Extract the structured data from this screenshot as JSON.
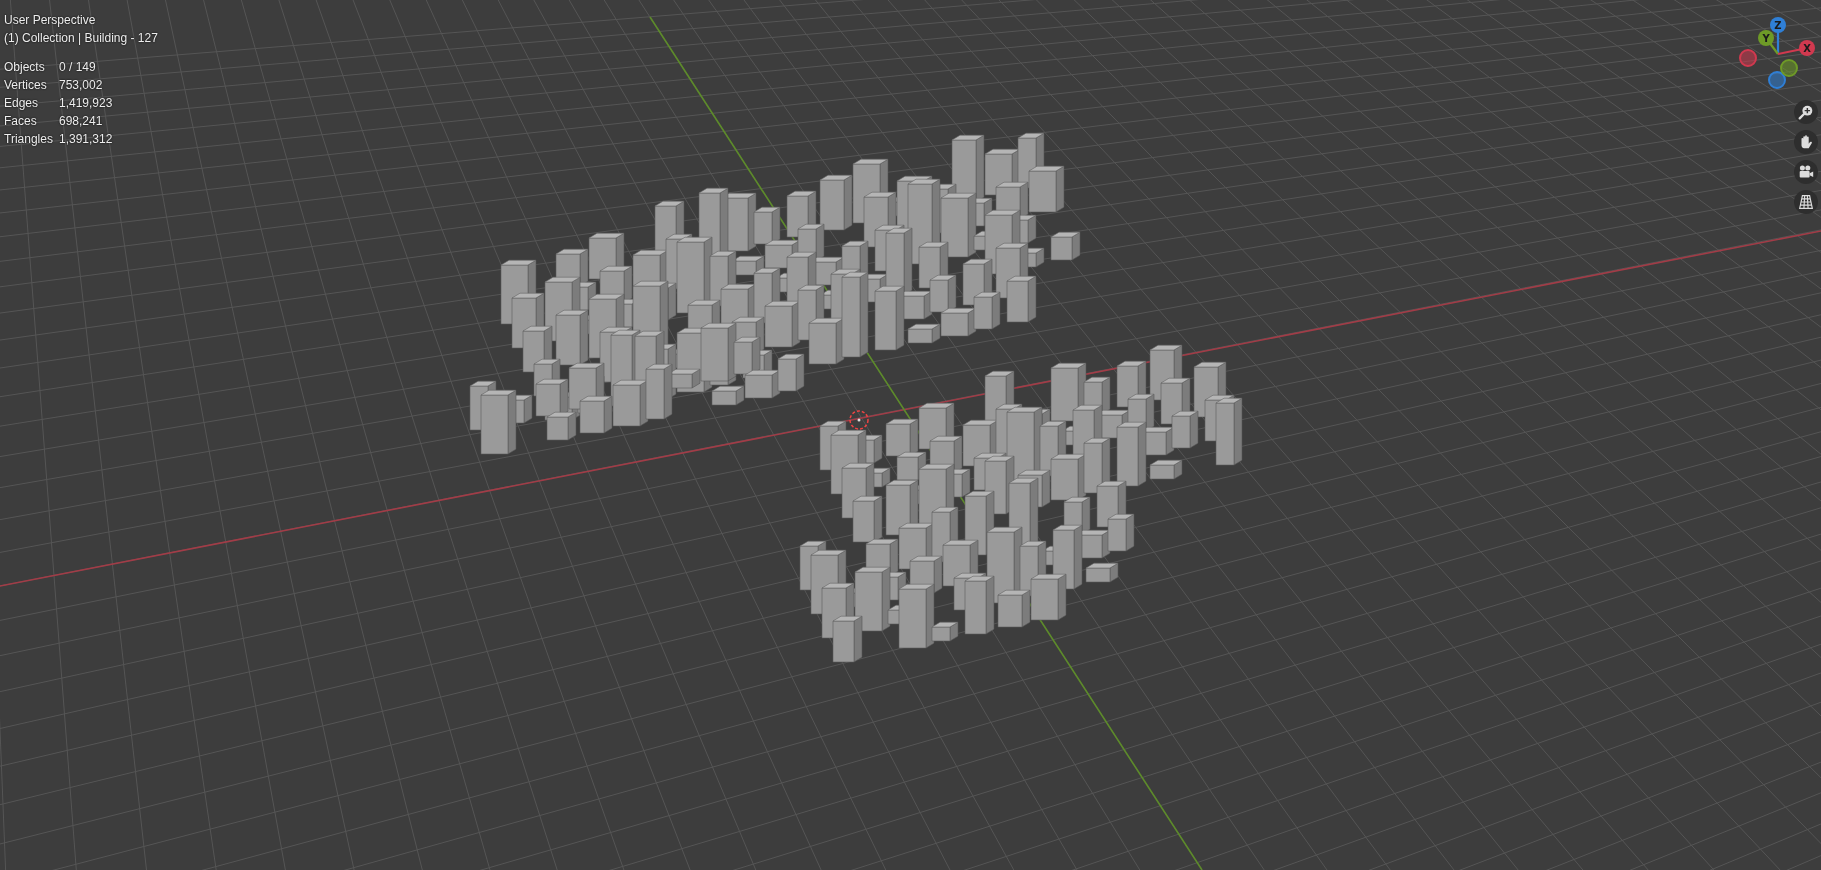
{
  "viewport": {
    "view_name": "User Perspective",
    "collection_line": "(1) Collection | Building - 127"
  },
  "stats": [
    {
      "label": "Objects",
      "value": "0 / 149"
    },
    {
      "label": "Vertices",
      "value": "753,002"
    },
    {
      "label": "Edges",
      "value": "1,419,923"
    },
    {
      "label": "Faces",
      "value": "698,241"
    },
    {
      "label": "Triangles",
      "value": "1,391,312"
    }
  ],
  "gizmo": {
    "axes": [
      {
        "label": "Z",
        "color": "#2f7fd6"
      },
      {
        "label": "Y",
        "color": "#6e9a27"
      },
      {
        "label": "X",
        "color": "#d1394f"
      }
    ]
  }
}
